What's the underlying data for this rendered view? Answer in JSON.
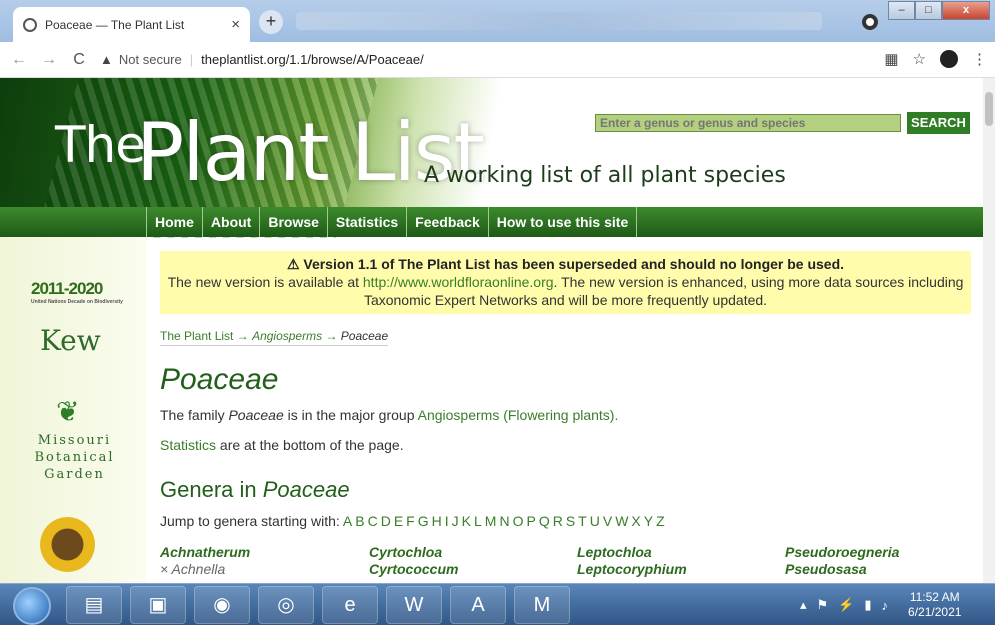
{
  "browser": {
    "tab_title": "Poaceae — The Plant List",
    "tab_close": "×",
    "new_tab": "+",
    "security": "Not secure",
    "url": "theplantlist.org/1.1/browse/A/Poaceae/",
    "win_min": "–",
    "win_max": "□",
    "win_close": "x"
  },
  "header": {
    "logo_the": "The",
    "logo_main": "Plant List",
    "tagline": "A working list of all plant species",
    "search_placeholder": "Enter a genus or genus and species",
    "search_button": "SEARCH"
  },
  "nav": [
    "Home",
    "About",
    "Browse",
    "Statistics",
    "Feedback",
    "How to use this site"
  ],
  "sidebar": {
    "logo_2010": "2011-2020",
    "logo_2010_sub": "United Nations Decade on Biodiversity",
    "kew": "Kew",
    "mobot_line1": "Missouri",
    "mobot_line2": "Botanical",
    "mobot_line3": "Garden"
  },
  "notice": {
    "heading": "⚠ Version 1.1 of The Plant List has been superseded and should no longer be used.",
    "text_pre": "The new version is available at ",
    "link": "http://www.worldfloraonline.org",
    "text_post": ". The new version is enhanced, using more data sources including Taxonomic Expert Networks and will be more frequently updated."
  },
  "breadcrumb": {
    "root": "The Plant List",
    "arrow": "→",
    "group": "Angiosperms",
    "family": "Poaceae"
  },
  "main": {
    "title": "Poaceae",
    "p1_pre": "The family ",
    "p1_family": "Poaceae",
    "p1_mid": " is in the major group ",
    "p1_group": "Angiosperms",
    "p1_post": " (Flowering plants).",
    "p2_link": "Statistics",
    "p2_post": " are at the bottom of the page.",
    "genera_heading_pre": "Genera in ",
    "genera_heading_family": "Poaceae",
    "jump_label": "Jump to genera starting with:",
    "letters": [
      "A",
      "B",
      "C",
      "D",
      "E",
      "F",
      "G",
      "H",
      "I",
      "J",
      "K",
      "L",
      "M",
      "N",
      "O",
      "P",
      "Q",
      "R",
      "S",
      "T",
      "U",
      "V",
      "W",
      "X",
      "Y",
      "Z"
    ]
  },
  "genera": [
    [
      "Achnatherum",
      "Cyrtochloa",
      "Leptochloa",
      "Pseudoroegneria"
    ],
    [
      "× Achnella",
      "Cyrtococcum",
      "Leptocoryphium",
      "Pseudosasa"
    ]
  ],
  "taskbar": {
    "time": "11:52 AM",
    "date": "6/21/2021"
  }
}
